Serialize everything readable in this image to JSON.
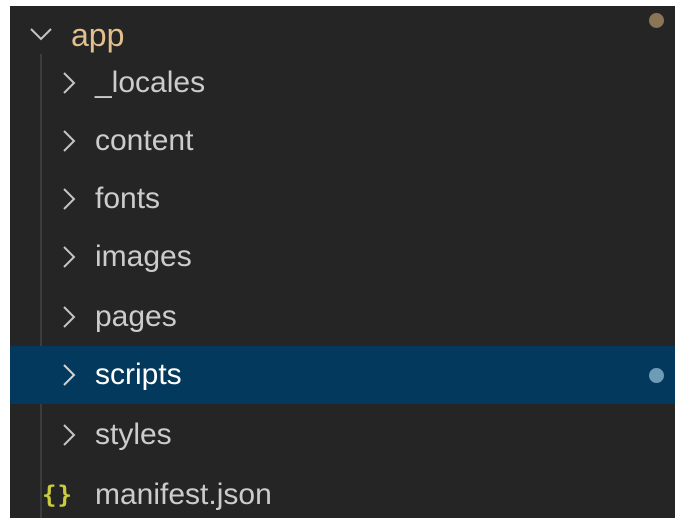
{
  "explorer": {
    "root": {
      "label": "app",
      "expanded": true,
      "label_color": "#e2c08d",
      "status_dot_color": "#8a7656"
    },
    "items": [
      {
        "label": "_locales",
        "type": "folder",
        "expanded": false,
        "selected": false
      },
      {
        "label": "content",
        "type": "folder",
        "expanded": false,
        "selected": false
      },
      {
        "label": "fonts",
        "type": "folder",
        "expanded": false,
        "selected": false
      },
      {
        "label": "images",
        "type": "folder",
        "expanded": false,
        "selected": false
      },
      {
        "label": "pages",
        "type": "folder",
        "expanded": false,
        "selected": false
      },
      {
        "label": "scripts",
        "type": "folder",
        "expanded": false,
        "selected": true,
        "status_dot_color": "#6e9bb5"
      },
      {
        "label": "styles",
        "type": "folder",
        "expanded": false,
        "selected": false
      },
      {
        "label": "manifest.json",
        "type": "file",
        "icon": "{}"
      }
    ],
    "colors": {
      "background": "#252526",
      "selection": "#04395e",
      "text": "#cccccc",
      "selected_text": "#ffffff",
      "json_icon": "#cbcb41"
    },
    "icons": {
      "expanded": "chevron-down-icon",
      "collapsed": "chevron-right-icon",
      "json_file": "json-braces-icon"
    }
  }
}
